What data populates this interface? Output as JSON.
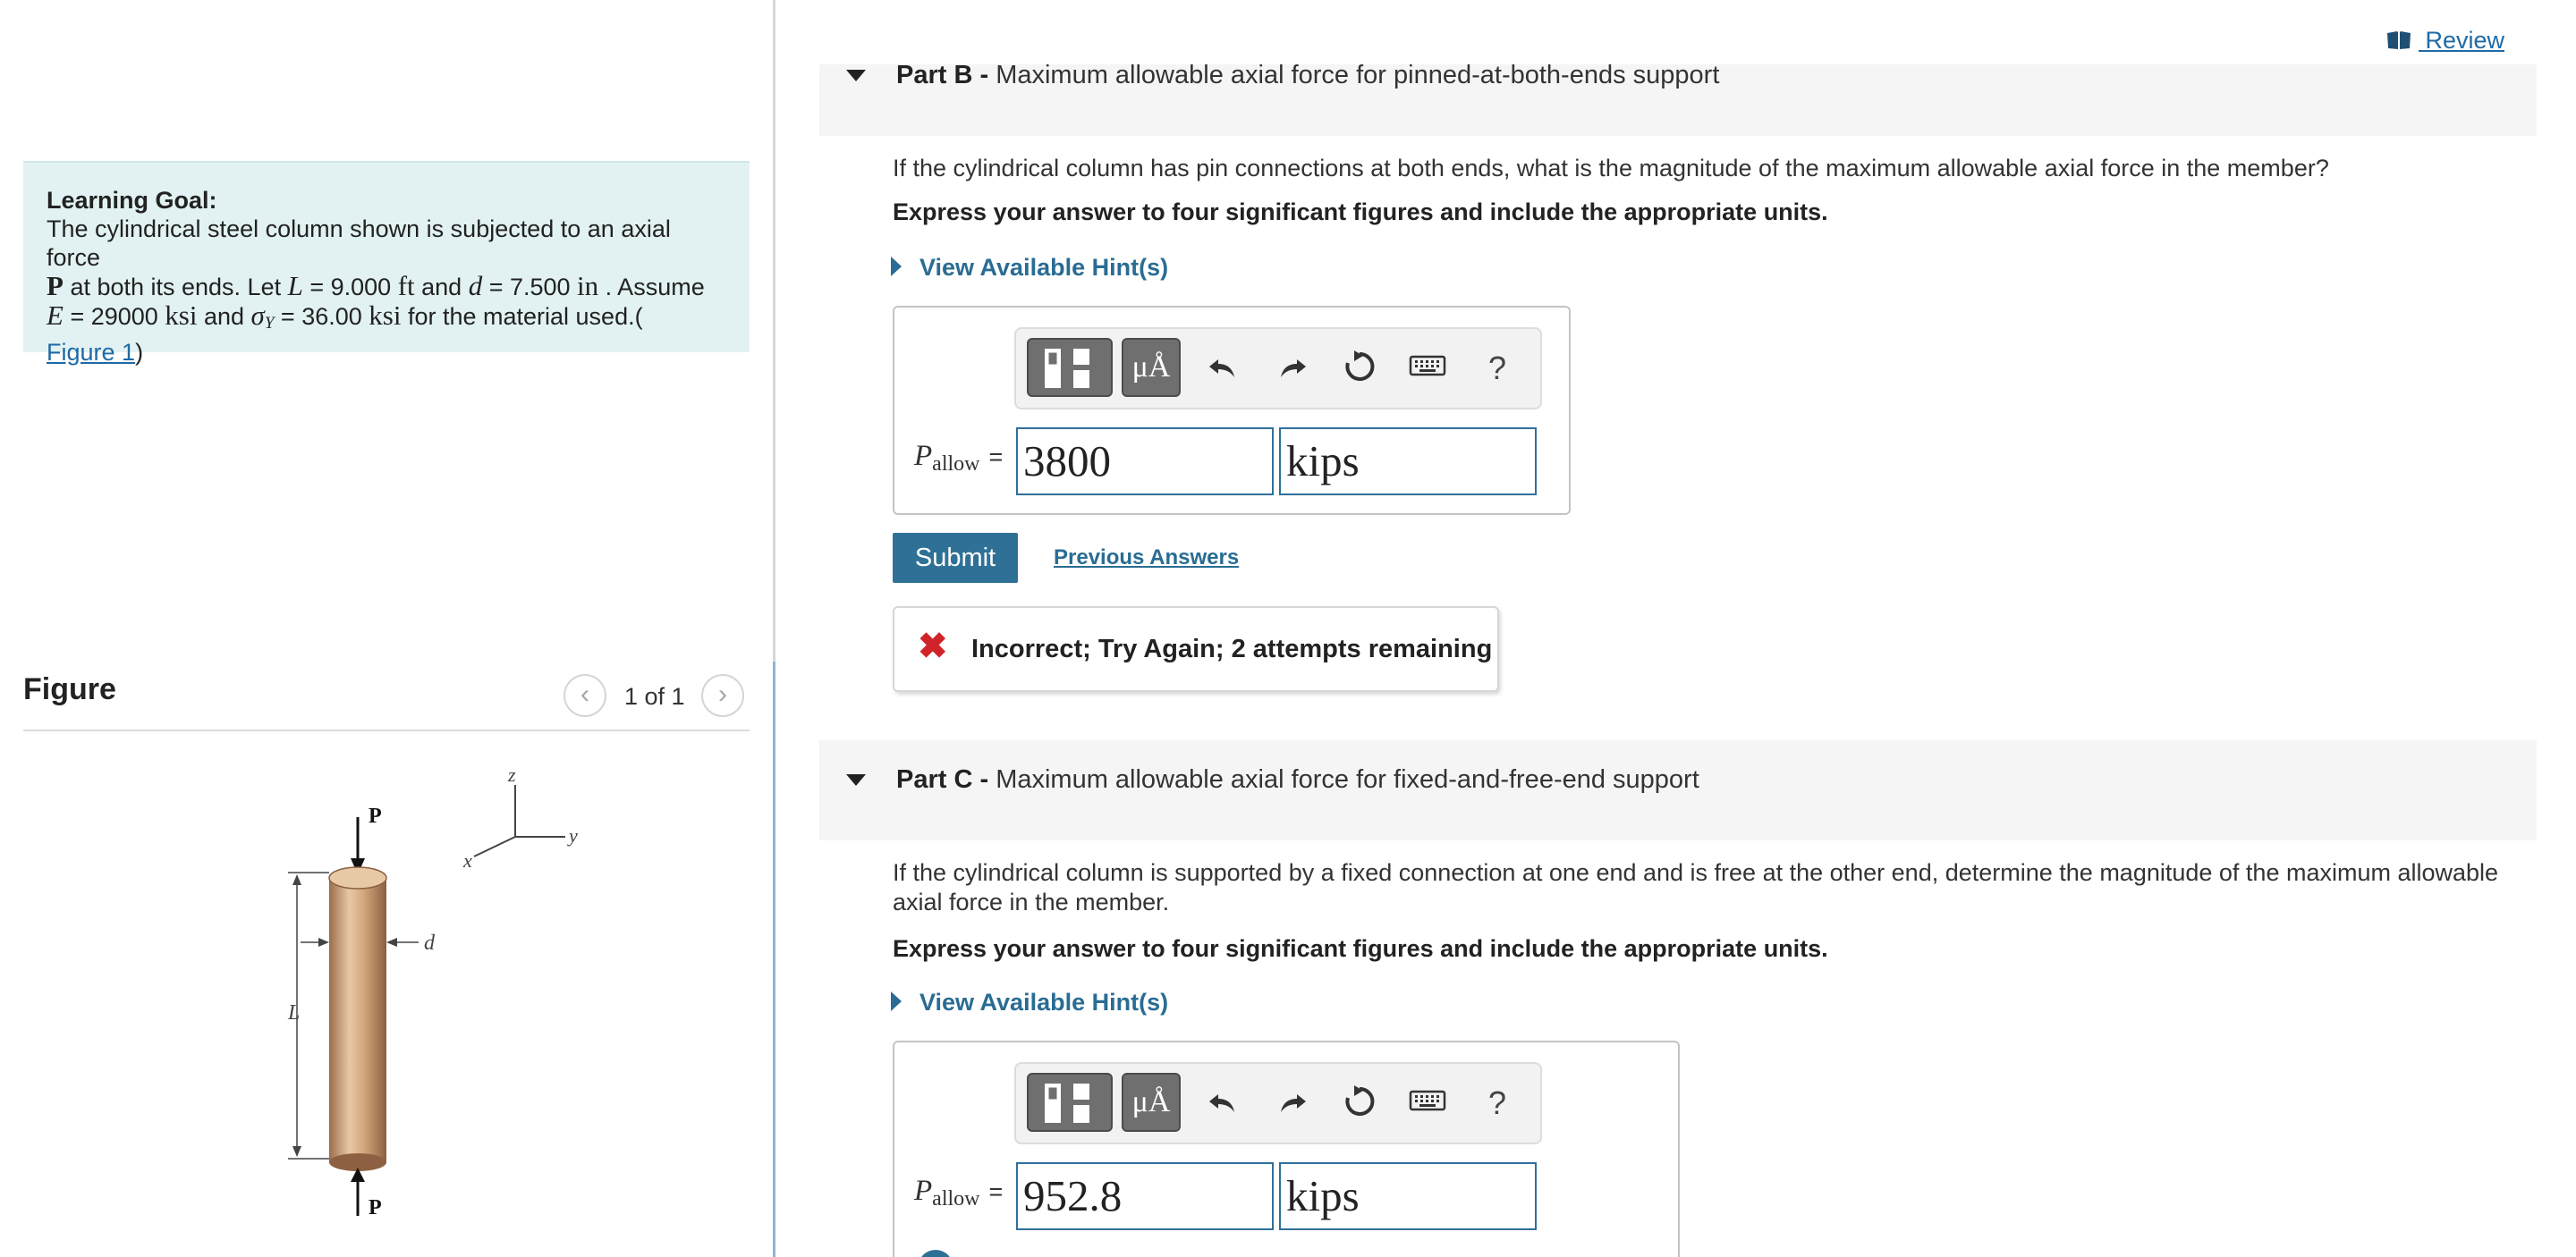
{
  "left": {
    "learning_goal": {
      "title": "Learning Goal:",
      "line1": "The cylindrical steel column shown is subjected to an axial force",
      "force_symbol": "P",
      "line2_a": " at both its ends. Let ",
      "L_symbol": "L",
      "L_value": " = 9.000 ",
      "L_unit": "ft",
      "and1": " and ",
      "d_symbol": "d",
      "d_value": " = 7.500 ",
      "d_unit": "in",
      "assume": " . Assume",
      "E_symbol": "E",
      "E_value": " = 29000 ",
      "E_unit": "ksi",
      "and2": " and ",
      "sigma_symbol": "σ",
      "sigma_sub": "Y",
      "sigma_value": " = 36.00 ",
      "sigma_unit": "ksi",
      "tail": " for the material used.(",
      "figure_link": "Figure 1",
      "close": ")"
    },
    "figure": {
      "title": "Figure",
      "prev_icon": "chevron-left-icon",
      "next_icon": "chevron-right-icon",
      "counter": "1 of 1",
      "labels": {
        "top_force": "P",
        "bottom_force": "P",
        "length": "L",
        "diameter": "d",
        "axis_x": "x",
        "axis_y": "y",
        "axis_z": "z"
      }
    }
  },
  "right": {
    "review": {
      "label": " Review",
      "icon": "book-icon"
    },
    "part_b": {
      "prefix": "Part B - ",
      "title": "Maximum allowable axial force for pinned-at-both-ends support",
      "question": "If the cylindrical column has pin connections at both ends, what is the magnitude of the maximum allowable axial force in the member?",
      "instruction": "Express your answer to four significant figures and include the appropriate units.",
      "hint": "View Available Hint(s)",
      "eq_symbol": "P",
      "eq_sub": "allow",
      "eq_sign": "=",
      "value": "3800",
      "units": "kips",
      "submit": "Submit",
      "previous_answers": "Previous Answers",
      "feedback_icon": "✖",
      "feedback": "Incorrect; Try Again; 2 attempts remaining"
    },
    "part_c": {
      "prefix": "Part C - ",
      "title": "Maximum allowable axial force for fixed-and-free-end support",
      "question": "If the cylindrical column is supported by a fixed connection at one end and is free at the other end, determine the magnitude of the maximum allowable axial force in the member.",
      "instruction": "Express your answer to four significant figures and include the appropriate units.",
      "hint": "View Available Hint(s)",
      "eq_symbol": "P",
      "eq_sub": "allow",
      "eq_sign": "=",
      "value": "952.8",
      "units": "kips"
    },
    "toolbar": {
      "units_label": "μÅ",
      "help_label": "?",
      "icons": [
        "templates-icon",
        "units-icon",
        "undo-icon",
        "redo-icon",
        "reset-icon",
        "keyboard-icon",
        "help-icon"
      ]
    }
  }
}
